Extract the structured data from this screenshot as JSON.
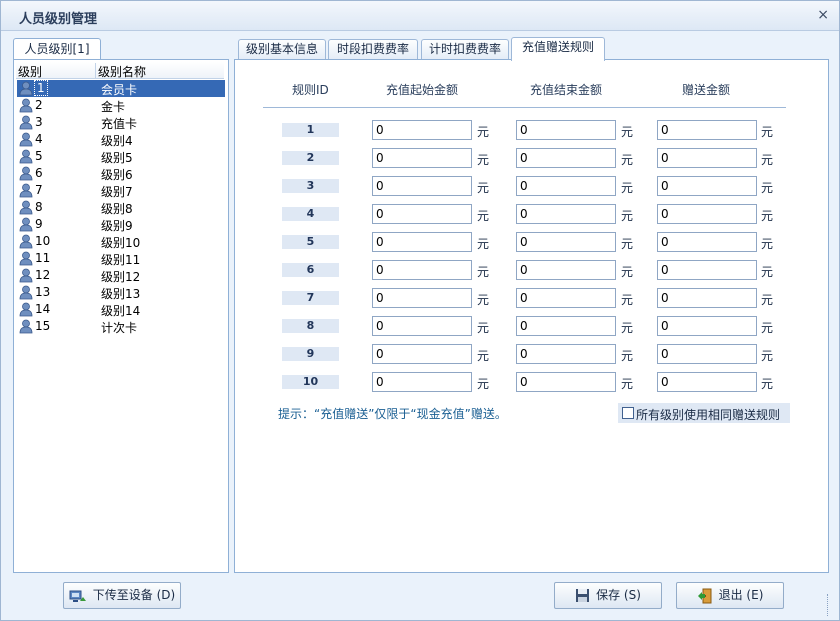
{
  "window": {
    "title": "人员级别管理",
    "close_glyph": "×"
  },
  "left": {
    "tab_label": "人员级别[1]",
    "col_level": "级别",
    "col_name": "级别名称",
    "items": [
      {
        "id": "1",
        "name": "会员卡",
        "selected": true
      },
      {
        "id": "2",
        "name": "金卡"
      },
      {
        "id": "3",
        "name": "充值卡"
      },
      {
        "id": "4",
        "name": "级别4"
      },
      {
        "id": "5",
        "name": "级别5"
      },
      {
        "id": "6",
        "name": "级别6"
      },
      {
        "id": "7",
        "name": "级别7"
      },
      {
        "id": "8",
        "name": "级别8"
      },
      {
        "id": "9",
        "name": "级别9"
      },
      {
        "id": "10",
        "name": "级别10"
      },
      {
        "id": "11",
        "name": "级别11"
      },
      {
        "id": "12",
        "name": "级别12"
      },
      {
        "id": "13",
        "name": "级别13"
      },
      {
        "id": "14",
        "name": "级别14"
      },
      {
        "id": "15",
        "name": "计次卡"
      }
    ]
  },
  "tabs": [
    {
      "label": "级别基本信息"
    },
    {
      "label": "时段扣费费率"
    },
    {
      "label": "计时扣费费率"
    },
    {
      "label": "充值赠送规则",
      "active": true
    }
  ],
  "rules": {
    "col_id": "规则ID",
    "col_start": "充值起始金额",
    "col_end": "充值结束金额",
    "col_gift": "赠送金额",
    "unit": "元",
    "rows": [
      {
        "id": "1",
        "start": "0",
        "end": "0",
        "gift": "0"
      },
      {
        "id": "2",
        "start": "0",
        "end": "0",
        "gift": "0"
      },
      {
        "id": "3",
        "start": "0",
        "end": "0",
        "gift": "0"
      },
      {
        "id": "4",
        "start": "0",
        "end": "0",
        "gift": "0"
      },
      {
        "id": "5",
        "start": "0",
        "end": "0",
        "gift": "0"
      },
      {
        "id": "6",
        "start": "0",
        "end": "0",
        "gift": "0"
      },
      {
        "id": "7",
        "start": "0",
        "end": "0",
        "gift": "0"
      },
      {
        "id": "8",
        "start": "0",
        "end": "0",
        "gift": "0"
      },
      {
        "id": "9",
        "start": "0",
        "end": "0",
        "gift": "0"
      },
      {
        "id": "10",
        "start": "0",
        "end": "0",
        "gift": "0"
      }
    ],
    "hint": "提示：“充值赠送”仅限于“现金充值”赠送。",
    "same_rule_label": "所有级别使用相同赠送规则"
  },
  "buttons": {
    "upload": "下传至设备 (D)",
    "save": "保存 (S)",
    "exit": "退出 (E)"
  },
  "colors": {
    "accent": "#3569b5",
    "border": "#8fb0d6",
    "background": "#eaf2fb"
  }
}
